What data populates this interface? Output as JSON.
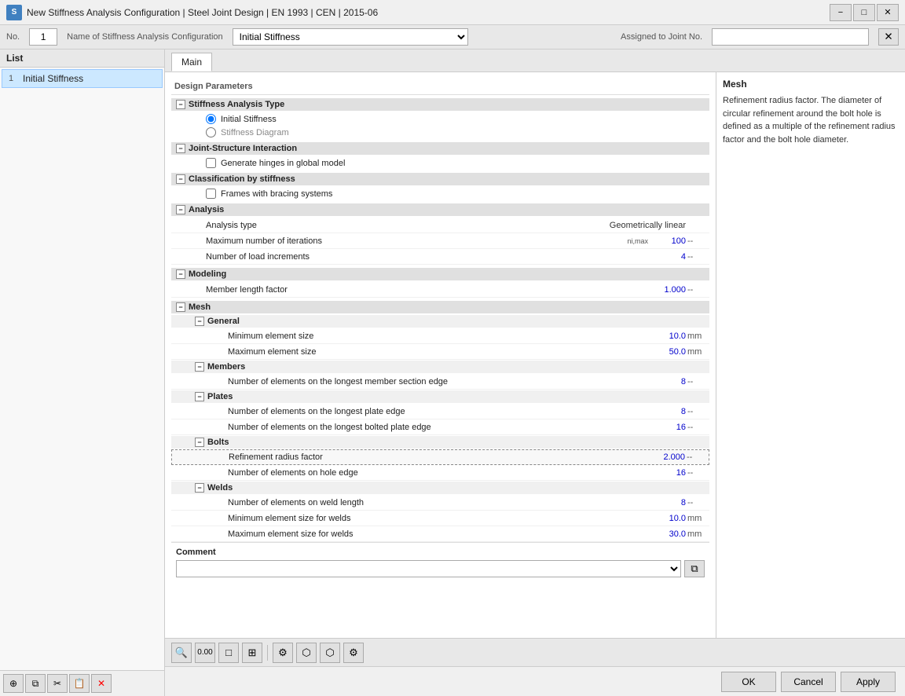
{
  "window": {
    "title": "New Stiffness Analysis Configuration | Steel Joint Design | EN 1993 | CEN | 2015-06",
    "min_label": "−",
    "max_label": "□",
    "close_label": "✕"
  },
  "left_panel": {
    "header": "List",
    "items": [
      {
        "number": "1",
        "label": "Initial Stiffness"
      }
    ],
    "toolbar": {
      "add_icon": "⊕",
      "copy_icon": "⧉",
      "cut_icon": "✂",
      "paste_icon": "📋",
      "delete_icon": "✕"
    }
  },
  "config_header": {
    "no_label": "No.",
    "no_value": "1",
    "name_label": "Name of Stiffness Analysis Configuration",
    "name_value": "Initial Stiffness",
    "assigned_label": "Assigned to Joint No.",
    "assigned_value": ""
  },
  "tab": {
    "label": "Main"
  },
  "design_params": {
    "header": "Design Parameters",
    "stiffness_analysis_type": "Stiffness Analysis Type",
    "initial_stiffness_radio": "Initial Stiffness",
    "stiffness_diagram_radio": "Stiffness Diagram",
    "joint_structure": "Joint-Structure Interaction",
    "generate_hinges": "Generate hinges in global model",
    "classification": "Classification by stiffness",
    "frames_bracing": "Frames with bracing systems",
    "analysis": "Analysis",
    "analysis_type_label": "Analysis type",
    "analysis_type_value": "Geometrically linear",
    "max_iterations_label": "Maximum number of iterations",
    "max_iterations_subscript": "ni,max",
    "max_iterations_value": "100",
    "max_iterations_unit": "--",
    "load_increments_label": "Number of load increments",
    "load_increments_value": "4",
    "load_increments_unit": "--",
    "modeling": "Modeling",
    "member_length_label": "Member length factor",
    "member_length_value": "1.000",
    "member_length_unit": "--",
    "mesh": "Mesh",
    "general": "General",
    "min_element_label": "Minimum element size",
    "min_element_value": "10.0",
    "min_element_unit": "mm",
    "max_element_label": "Maximum element size",
    "max_element_value": "50.0",
    "max_element_unit": "mm",
    "members": "Members",
    "members_longest_label": "Number of elements on the longest member section edge",
    "members_longest_value": "8",
    "members_longest_unit": "--",
    "plates": "Plates",
    "plates_longest_label": "Number of elements on the longest plate edge",
    "plates_longest_value": "8",
    "plates_longest_unit": "--",
    "plates_bolted_label": "Number of elements on the longest bolted plate edge",
    "plates_bolted_value": "16",
    "plates_bolted_unit": "--",
    "bolts": "Bolts",
    "bolts_radius_label": "Refinement radius factor",
    "bolts_radius_value": "2.000",
    "bolts_radius_unit": "--",
    "bolts_hole_label": "Number of elements on hole edge",
    "bolts_hole_value": "16",
    "bolts_hole_unit": "--",
    "welds": "Welds",
    "welds_length_label": "Number of elements on weld length",
    "welds_length_value": "8",
    "welds_length_unit": "--",
    "welds_min_label": "Minimum element size for welds",
    "welds_min_value": "10.0",
    "welds_min_unit": "mm",
    "welds_max_label": "Maximum element size for welds",
    "welds_max_value": "30.0",
    "welds_max_unit": "mm"
  },
  "comment": {
    "label": "Comment",
    "value": "",
    "placeholder": ""
  },
  "info_panel": {
    "title": "Mesh",
    "text": "Refinement radius factor. The diameter of circular refinement around the bolt hole is defined as a multiple of the refinement radius factor and the bolt hole diameter."
  },
  "bottom_toolbar": {
    "icons": [
      "🔍",
      "0.00",
      "□",
      "⊞",
      "⚙",
      "⬡",
      "⬡",
      "⚙"
    ]
  },
  "dialog": {
    "ok_label": "OK",
    "cancel_label": "Cancel",
    "apply_label": "Apply"
  }
}
